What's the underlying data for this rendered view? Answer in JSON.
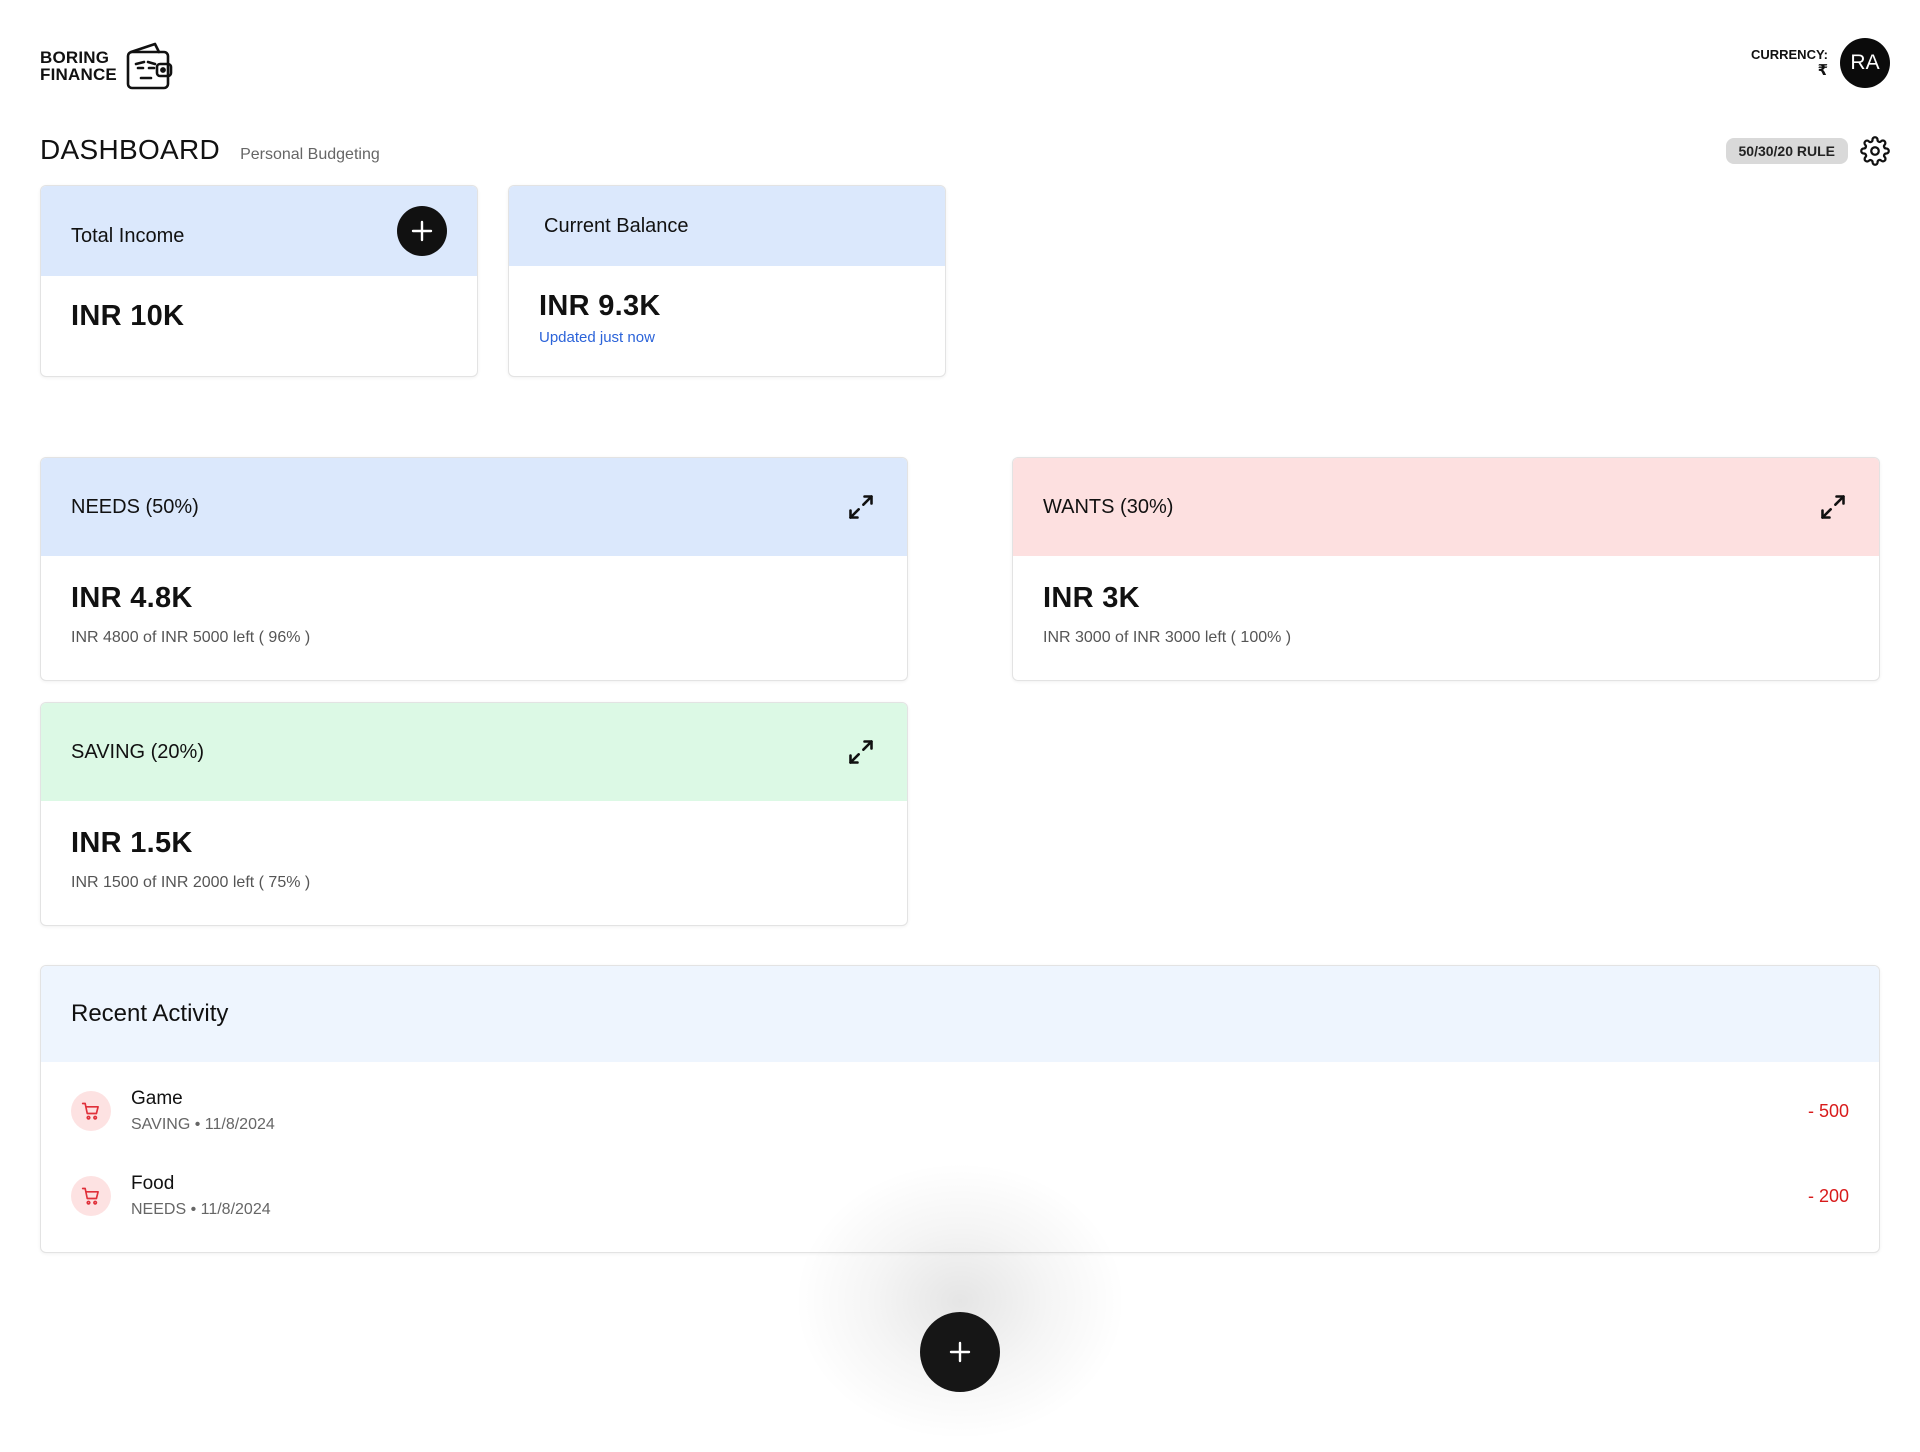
{
  "brand": {
    "line1": "BORING",
    "line2": "FINANCE",
    "logo_icon": "wallet-face-icon"
  },
  "header": {
    "currency_label": "CURRENCY:",
    "currency_symbol": "₹",
    "avatar_initials": "RA"
  },
  "page": {
    "title": "DASHBOARD",
    "subtitle": "Personal Budgeting",
    "rule_badge": "50/30/20 RULE"
  },
  "summary": {
    "income": {
      "label": "Total Income",
      "value": "INR 10K"
    },
    "balance": {
      "label": "Current Balance",
      "value": "INR 9.3K",
      "updated": "Updated just now"
    }
  },
  "buckets": {
    "needs": {
      "label": "NEEDS (50%)",
      "value": "INR 4.8K",
      "detail": "INR 4800 of INR 5000 left ( 96% )",
      "color": "#dbe8fc"
    },
    "wants": {
      "label": "WANTS (30%)",
      "value": "INR 3K",
      "detail": "INR 3000 of INR 3000 left ( 100% )",
      "color": "#fde0e0"
    },
    "saving": {
      "label": "SAVING (20%)",
      "value": "INR 1.5K",
      "detail": "INR 1500 of INR 2000 left ( 75% )",
      "color": "#dcf9e5"
    }
  },
  "activity": {
    "title": "Recent Activity",
    "items": [
      {
        "name": "Game",
        "meta": "SAVING • 11/8/2024",
        "amount": "- 500",
        "icon": "cart-icon"
      },
      {
        "name": "Food",
        "meta": "NEEDS • 11/8/2024",
        "amount": "- 200",
        "icon": "cart-icon"
      }
    ]
  },
  "colors": {
    "accent_dark": "#111111",
    "negative": "#d81b1b",
    "link": "#2b63d9"
  }
}
